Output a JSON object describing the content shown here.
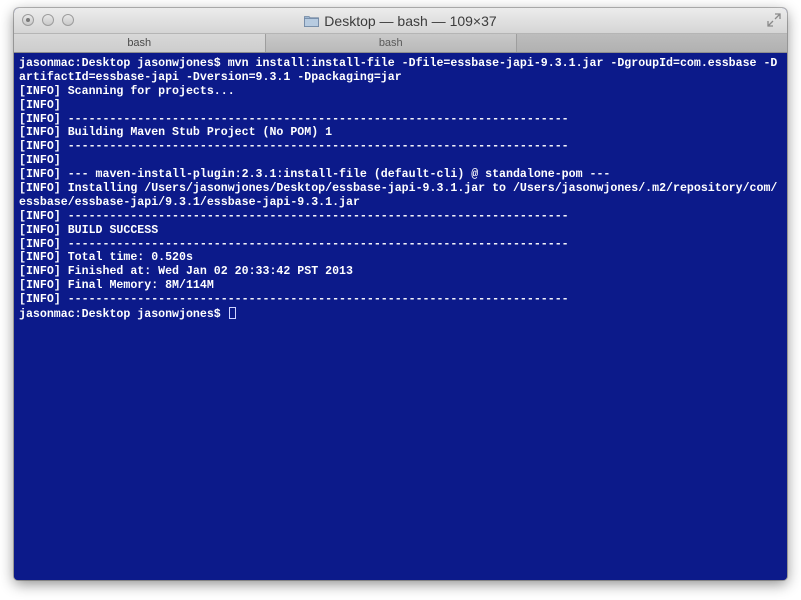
{
  "window": {
    "title": "Desktop — bash — 109×37"
  },
  "tabs": [
    {
      "label": "bash",
      "active": true
    },
    {
      "label": "bash",
      "active": false
    }
  ],
  "terminal": {
    "lines": [
      "jasonmac:Desktop jasonwjones$ mvn install:install-file -Dfile=essbase-japi-9.3.1.jar -DgroupId=com.essbase -D",
      "artifactId=essbase-japi -Dversion=9.3.1 -Dpackaging=jar",
      "[INFO] Scanning for projects...",
      "[INFO]",
      "[INFO] ------------------------------------------------------------------------",
      "[INFO] Building Maven Stub Project (No POM) 1",
      "[INFO] ------------------------------------------------------------------------",
      "[INFO]",
      "[INFO] --- maven-install-plugin:2.3.1:install-file (default-cli) @ standalone-pom ---",
      "[INFO] Installing /Users/jasonwjones/Desktop/essbase-japi-9.3.1.jar to /Users/jasonwjones/.m2/repository/com/",
      "essbase/essbase-japi/9.3.1/essbase-japi-9.3.1.jar",
      "[INFO] ------------------------------------------------------------------------",
      "[INFO] BUILD SUCCESS",
      "[INFO] ------------------------------------------------------------------------",
      "[INFO] Total time: 0.520s",
      "[INFO] Finished at: Wed Jan 02 20:33:42 PST 2013",
      "[INFO] Final Memory: 8M/114M",
      "[INFO] ------------------------------------------------------------------------"
    ],
    "prompt": "jasonmac:Desktop jasonwjones$ ",
    "background_color": "#0c1a8a",
    "text_color": "#ffffff"
  }
}
